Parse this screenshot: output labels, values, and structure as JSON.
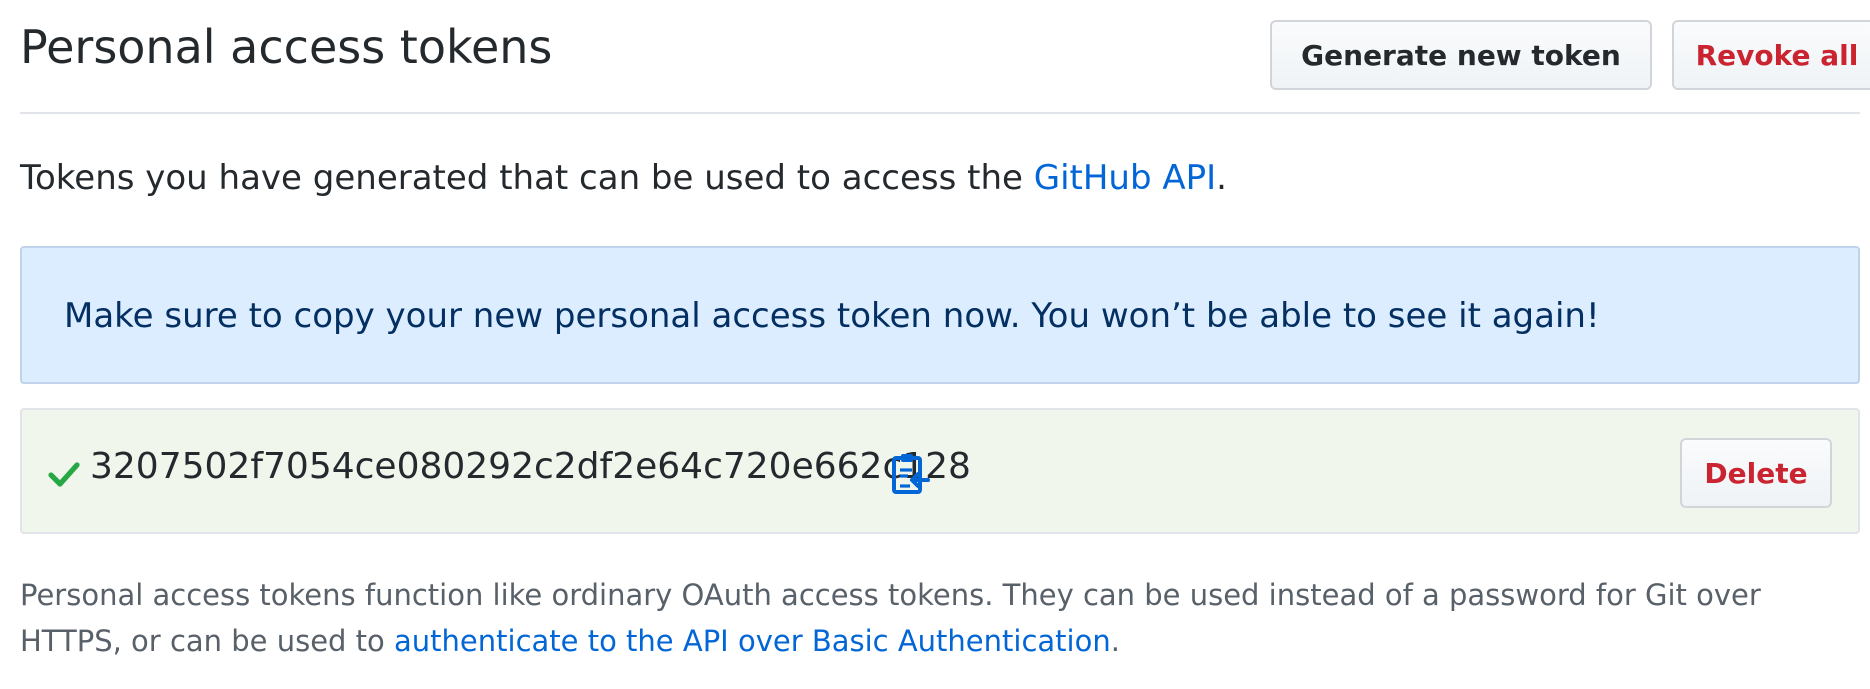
{
  "header": {
    "title": "Personal access tokens",
    "generate_label": "Generate new token",
    "revoke_label": "Revoke all"
  },
  "intro": {
    "text": "Tokens you have generated that can be used to access the ",
    "link_text": "GitHub API",
    "suffix": "."
  },
  "flash": {
    "message": "Make sure to copy your new personal access token now. You won’t be able to see it again!"
  },
  "token": {
    "value": "3207502f7054ce080292c2df2e64c720e662c128",
    "status_icon": "check-icon",
    "copy_icon": "clipboard-icon",
    "delete_label": "Delete"
  },
  "note": {
    "text": "Personal access tokens function like ordinary OAuth access tokens. They can be used instead of a password for Git over HTTPS, or can be used to ",
    "link_text": "authenticate to the API over Basic Authentication",
    "suffix": "."
  },
  "colors": {
    "link": "#0366d6",
    "danger": "#cb2431",
    "success": "#28a745",
    "flash_bg": "#dbedff",
    "token_bg": "#f0f6ec"
  }
}
